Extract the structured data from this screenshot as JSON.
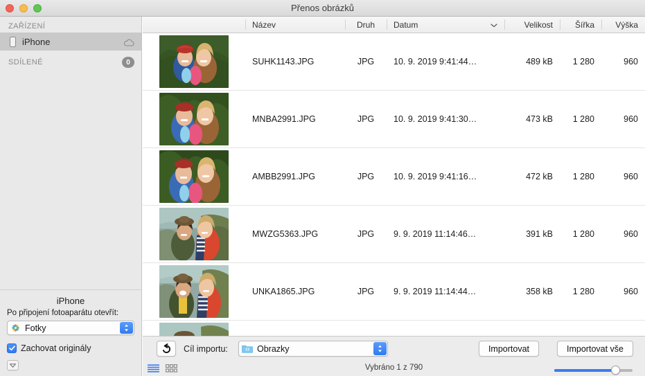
{
  "window": {
    "title": "Přenos obrázků",
    "traffic_lights": [
      "close",
      "minimize",
      "maximize"
    ]
  },
  "sidebar": {
    "sections": [
      {
        "header": "ZAŘÍZENÍ",
        "items": [
          {
            "label": "iPhone",
            "selected": true,
            "icon": "phone-icon",
            "trailing_icon": "cloud-icon"
          }
        ]
      },
      {
        "header": "SDÍLENÉ",
        "badge": "0",
        "items": []
      }
    ],
    "device_panel": {
      "device_name": "iPhone",
      "open_label": "Po připojení fotoaparátu otevřít:",
      "app_value": "Fotky",
      "keep_originals_label": "Zachovat originály",
      "keep_originals_checked": true
    }
  },
  "table": {
    "columns": [
      {
        "key": "thumb",
        "label": ""
      },
      {
        "key": "name",
        "label": "Název"
      },
      {
        "key": "kind",
        "label": "Druh"
      },
      {
        "key": "date",
        "label": "Datum",
        "sorted": true
      },
      {
        "key": "size",
        "label": "Velikost"
      },
      {
        "key": "width",
        "label": "Šířka"
      },
      {
        "key": "height",
        "label": "Výška"
      }
    ],
    "rows": [
      {
        "name": "SUHK1143.JPG",
        "kind": "JPG",
        "date": "10. 9. 2019 9:41:44…",
        "size": "489 kB",
        "width": "1 280",
        "height": "960",
        "thumb": "forest"
      },
      {
        "name": "MNBA2991.JPG",
        "kind": "JPG",
        "date": "10. 9. 2019 9:41:30…",
        "size": "473 kB",
        "width": "1 280",
        "height": "960",
        "thumb": "forest"
      },
      {
        "name": "AMBB2991.JPG",
        "kind": "JPG",
        "date": "10. 9. 2019 9:41:16…",
        "size": "472 kB",
        "width": "1 280",
        "height": "960",
        "thumb": "forest"
      },
      {
        "name": "MWZG5363.JPG",
        "kind": "JPG",
        "date": "9. 9. 2019 11:14:46…",
        "size": "391 kB",
        "width": "1 280",
        "height": "960",
        "thumb": "coast"
      },
      {
        "name": "UNKA1865.JPG",
        "kind": "JPG",
        "date": "9. 9. 2019 11:14:44…",
        "size": "358 kB",
        "width": "1 280",
        "height": "960",
        "thumb": "coast"
      },
      {
        "name": "",
        "kind": "",
        "date": "",
        "size": "",
        "width": "",
        "height": "",
        "thumb": "coast"
      }
    ]
  },
  "bottom_bar": {
    "rotate_icon": "rotate-left-icon",
    "destination_label": "Cíl importu:",
    "destination_value": "Obrazky",
    "import_button": "Importovat",
    "import_all_button": "Importovat vše",
    "status": "Vybráno 1 z 790",
    "view_list_icon": "list-view-icon",
    "view_grid_icon": "grid-view-icon",
    "active_view": "list",
    "zoom_slider_percent": 82
  },
  "colors": {
    "accent": "#3b7bf0",
    "sidebar_bg": "#e9e9e9",
    "selected_row": "#c9c9c9",
    "badge_bg": "#8e8e8e"
  }
}
